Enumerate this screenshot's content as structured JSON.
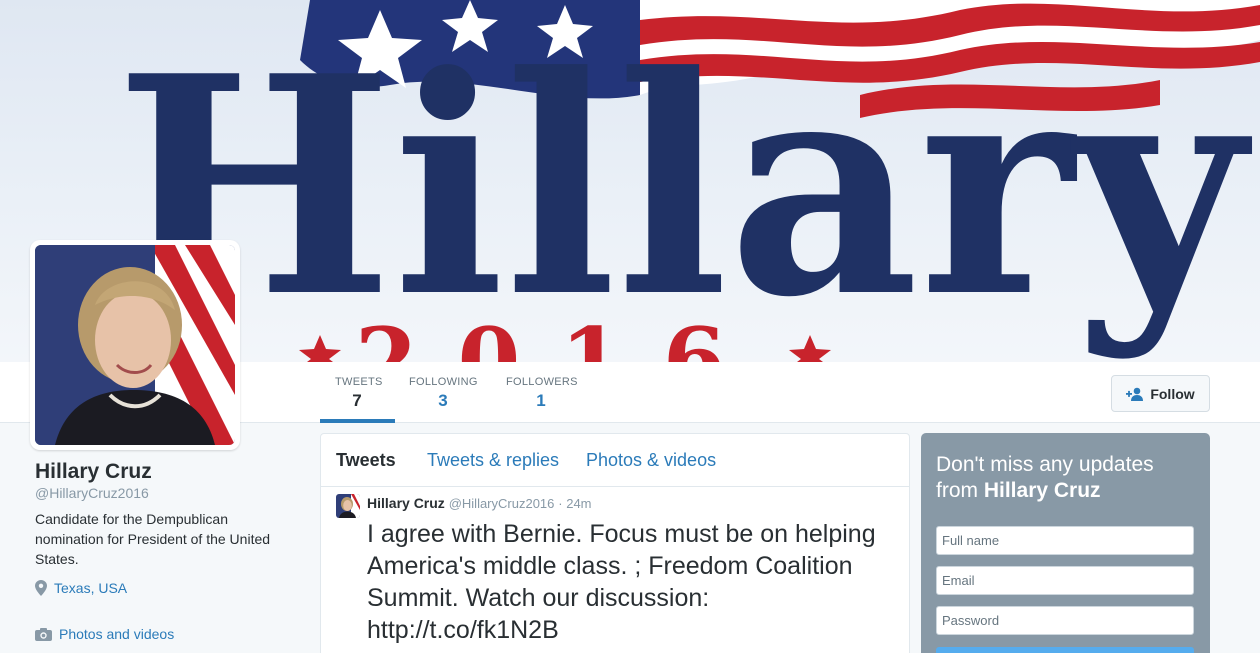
{
  "header": {
    "banner_logo_text": "Hillary",
    "banner_year_text": "2016"
  },
  "nav": {
    "stats": [
      {
        "label": "TWEETS",
        "value": "7"
      },
      {
        "label": "FOLLOWING",
        "value": "3"
      },
      {
        "label": "FOLLOWERS",
        "value": "1"
      }
    ],
    "follow_label": "Follow"
  },
  "profile": {
    "name": "Hillary Cruz",
    "handle": "@HillaryCruz2016",
    "bio": "Candidate for the Dempublican nomination for President of the United States.",
    "location": "Texas, USA",
    "photos_link": "Photos and videos"
  },
  "timeline": {
    "tabs": [
      "Tweets",
      "Tweets & replies",
      "Photos & videos"
    ],
    "tweet": {
      "name": "Hillary Cruz",
      "handle": "@HillaryCruz2016",
      "time": "· 24m",
      "text": "I agree with Bernie. Focus must be on helping America's middle class.  ; Freedom Coalition Summit. Watch our discussion: http://t.co/fk1N2B"
    }
  },
  "signup": {
    "title_prefix": "Don't miss any updates from",
    "title_name": "Hillary Cruz",
    "fields": {
      "full_name_placeholder": "Full name",
      "email_placeholder": "Email",
      "password_placeholder": "Password"
    }
  },
  "colors": {
    "link_blue": "#2b7bb9",
    "banner_navy": "#1f3164",
    "banner_red": "#c8232c",
    "signup_gray": "#8899a6"
  },
  "icons": {
    "location": "map-pin-icon",
    "photos": "camera-icon",
    "follow": "add-user-icon"
  }
}
